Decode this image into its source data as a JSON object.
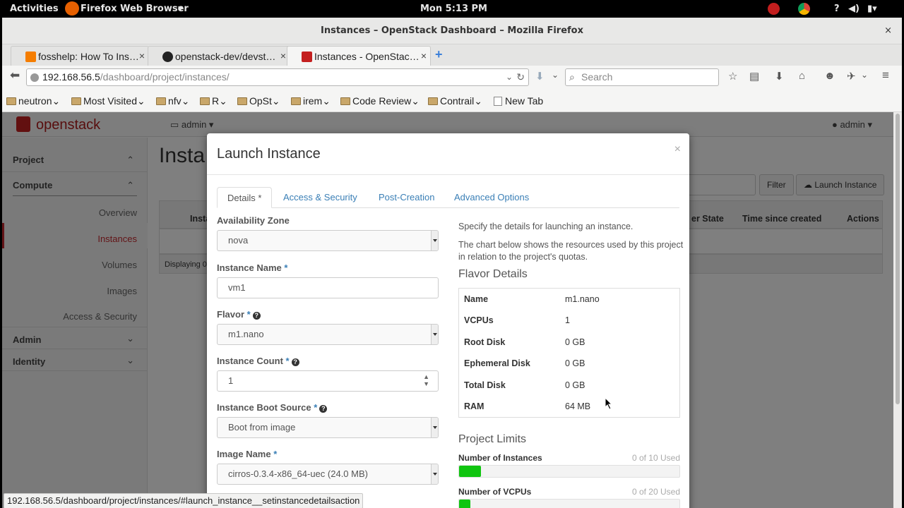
{
  "topbar": {
    "activities": "Activities",
    "app": "Firefox Web Browser",
    "clock": "Mon  5:13 PM"
  },
  "window": {
    "title": "Instances – OpenStack Dashboard – Mozilla Firefox",
    "close": "×"
  },
  "tabs": [
    {
      "label": "fosshelp: How To Ins…",
      "close": "×"
    },
    {
      "label": "openstack-dev/devst…",
      "close": "×"
    },
    {
      "label": "Instances - OpenStac…",
      "close": "×"
    }
  ],
  "newtab": "+",
  "url": {
    "host": "192.168.56.5",
    "path": "/dashboard/project/instances/"
  },
  "search": {
    "placeholder": "Search"
  },
  "bookmarks": [
    "neutron",
    "Most Visited",
    "nfv",
    "R",
    "OpSt",
    "irem",
    "Code Review",
    "Contrail",
    "New Tab"
  ],
  "os": {
    "logo": "openstack",
    "project": "admin ▾",
    "user": "admin ▾"
  },
  "sidebar": {
    "project": "Project",
    "compute": "Compute",
    "items": [
      "Overview",
      "Instances",
      "Volumes",
      "Images",
      "Access & Security"
    ],
    "admin": "Admin",
    "identity": "Identity"
  },
  "background": {
    "title": "Insta",
    "filter": "Filter",
    "launch": "Launch Instance",
    "cols": [
      "Insta",
      "er State",
      "Time since created",
      "Actions"
    ],
    "displaying": "Displaying 0 i"
  },
  "modal": {
    "title": "Launch Instance",
    "close": "×",
    "tabs": [
      "Details *",
      "Access & Security",
      "Post-Creation",
      "Advanced Options"
    ],
    "fields": {
      "az_label": "Availability Zone",
      "az_value": "nova",
      "name_label": "Instance Name",
      "name_value": "vm1",
      "flavor_label": "Flavor",
      "flavor_value": "m1.nano",
      "count_label": "Instance Count",
      "count_value": "1",
      "boot_label": "Instance Boot Source",
      "boot_value": "Boot from image",
      "image_label": "Image Name",
      "image_value": "cirros-0.3.4-x86_64-uec (24.0 MB)",
      "req": "*"
    },
    "desc1": "Specify the details for launching an instance.",
    "desc2": "The chart below shows the resources used by this project in relation to the project's quotas.",
    "flavor_heading": "Flavor Details",
    "flavor_rows": [
      {
        "k": "Name",
        "v": "m1.nano"
      },
      {
        "k": "VCPUs",
        "v": "1"
      },
      {
        "k": "Root Disk",
        "v": "0 GB"
      },
      {
        "k": "Ephemeral Disk",
        "v": "0 GB"
      },
      {
        "k": "Total Disk",
        "v": "0 GB"
      },
      {
        "k": "RAM",
        "v": "64 MB"
      }
    ],
    "limits_heading": "Project Limits",
    "limits": [
      {
        "name": "Number of Instances",
        "used": "0 of 10 Used",
        "fill_fraction": 0.1
      },
      {
        "name": "Number of VCPUs",
        "used": "0 of 20 Used",
        "fill_fraction": 0.05
      }
    ]
  },
  "statusbar": "192.168.56.5/dashboard/project/instances/#launch_instance__setinstancedetailsaction",
  "colors": {
    "accent": "#3a7fb6",
    "active": "#c6292e",
    "progress": "#10c510"
  }
}
